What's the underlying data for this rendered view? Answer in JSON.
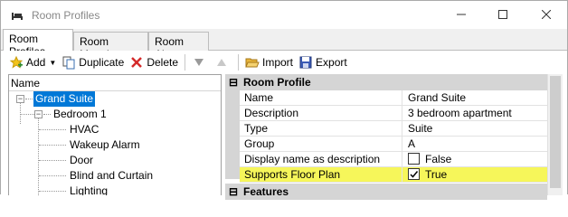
{
  "window": {
    "title": "Room Profiles",
    "icon": "bed-icon"
  },
  "tabs": [
    {
      "label": "Room Profiles",
      "active": true
    },
    {
      "label": "Room Mapping",
      "active": false
    },
    {
      "label": "Room Alerts",
      "active": false
    }
  ],
  "toolbar": {
    "add_label": "Add",
    "duplicate_label": "Duplicate",
    "delete_label": "Delete",
    "import_label": "Import",
    "export_label": "Export"
  },
  "tree": {
    "header": "Name",
    "items": [
      {
        "label": "Grand Suite",
        "level": 0,
        "expanded": true,
        "selected": true
      },
      {
        "label": "Bedroom 1",
        "level": 1,
        "expanded": true
      },
      {
        "label": "HVAC",
        "level": 2
      },
      {
        "label": "Wakeup Alarm",
        "level": 2
      },
      {
        "label": "Door",
        "level": 2
      },
      {
        "label": "Blind and Curtain",
        "level": 2
      },
      {
        "label": "Lighting",
        "level": 2
      }
    ]
  },
  "property_grid": {
    "category_room_profile": "Room Profile",
    "rows": [
      {
        "name": "Name",
        "value": "Grand Suite"
      },
      {
        "name": "Description",
        "value": "3 bedroom apartment"
      },
      {
        "name": "Type",
        "value": "Suite"
      },
      {
        "name": "Group",
        "value": "A"
      },
      {
        "name": "Display name as description",
        "value": "False",
        "checkbox": false
      },
      {
        "name": "Supports Floor Plan",
        "value": "True",
        "checkbox": true,
        "highlighted": true
      }
    ],
    "category_features": "Features"
  },
  "colors": {
    "selection": "#0078d7",
    "highlight": "#f6f65a"
  }
}
